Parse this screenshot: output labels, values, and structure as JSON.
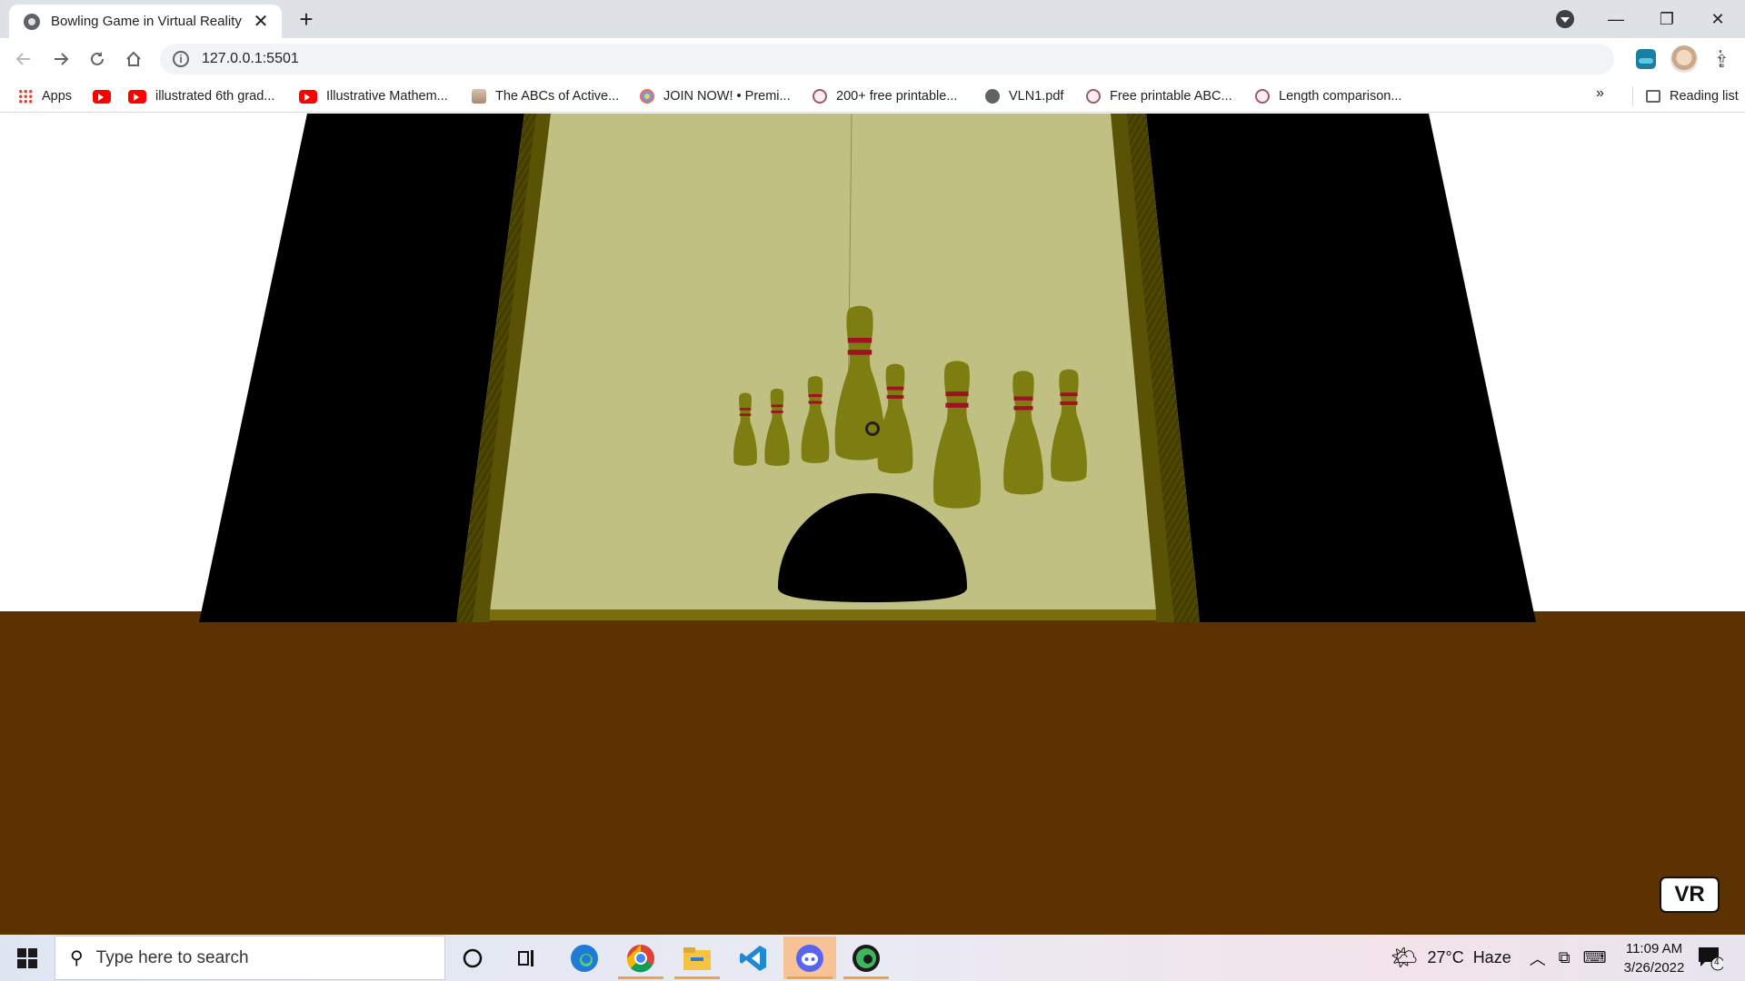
{
  "browser": {
    "tab_title": "Bowling Game in Virtual Reality",
    "close_glyph": "✕",
    "new_tab_glyph": "+",
    "url": "127.0.0.1:5501",
    "window_controls": {
      "minimize": "—",
      "restore": "❐",
      "close": "✕"
    }
  },
  "bookmarks": {
    "items": [
      {
        "label": "Apps",
        "icon": "apps-grid-icon"
      },
      {
        "label": "",
        "icon": "youtube-icon"
      },
      {
        "label": "illustrated 6th grad...",
        "icon": "youtube-icon"
      },
      {
        "label": "Illustrative Mathem...",
        "icon": "youtube-icon"
      },
      {
        "label": "The ABCs of Active...",
        "icon": "book-icon"
      },
      {
        "label": "JOIN NOW! • Premi...",
        "icon": "palette-icon"
      },
      {
        "label": "200+ free printable...",
        "icon": "stamp-icon"
      },
      {
        "label": "VLN1.pdf",
        "icon": "globe-icon"
      },
      {
        "label": "Free printable ABC...",
        "icon": "stamp-icon"
      },
      {
        "label": "Length comparison...",
        "icon": "stamp-icon"
      }
    ],
    "more_glyph": "»",
    "reading_list": "Reading list"
  },
  "scene": {
    "vr_button": "VR",
    "colors": {
      "floor": "#5c3300",
      "lane": "#c0c083",
      "gutter": "#4e4700",
      "pit_walls": "#000000",
      "pin": "#7d7d12",
      "pin_stripe": "#9e1222",
      "ball": "#000000"
    },
    "pin_count": 8
  },
  "taskbar": {
    "search_placeholder": "Type here to search",
    "apps": [
      "cortana-icon",
      "task-view-icon",
      "edge-icon",
      "chrome-icon",
      "file-explorer-icon",
      "vscode-icon",
      "discord-icon",
      "edge-dev-icon"
    ],
    "weather": {
      "temp": "27°C",
      "condition": "Haze"
    },
    "time": "11:09 AM",
    "date": "3/26/2022",
    "notification_count": "4"
  }
}
